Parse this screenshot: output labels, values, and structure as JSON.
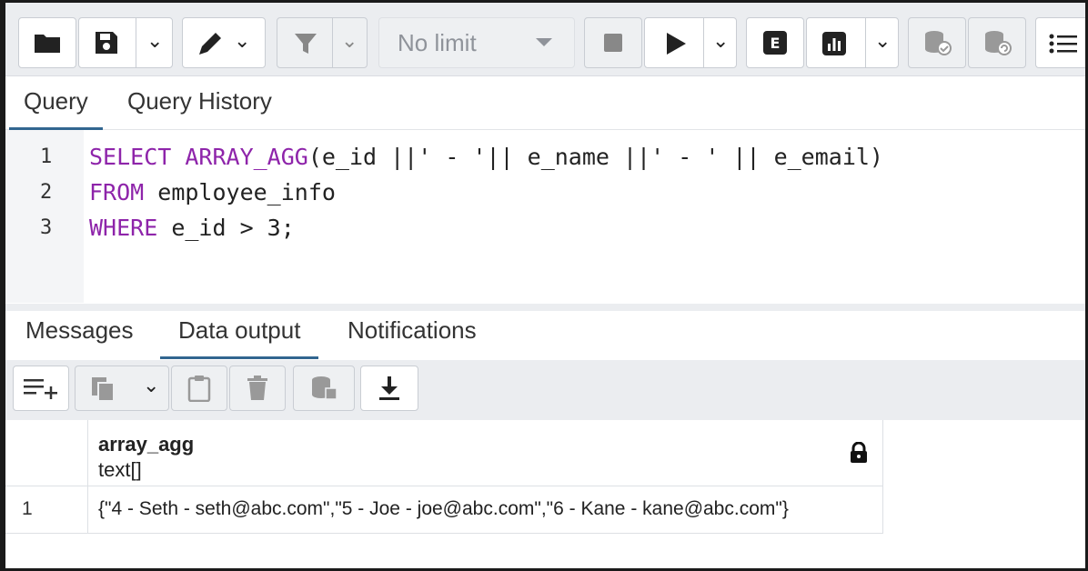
{
  "toolbar": {
    "limit_select": "No limit",
    "icons": [
      "folder-icon",
      "save-icon",
      "chevron-down-icon",
      "pen-icon",
      "filter-icon",
      "stop-icon",
      "play-icon",
      "explain-icon",
      "explain-analyze-icon",
      "commit-icon",
      "rollback-icon",
      "macros-icon"
    ]
  },
  "query_tabs": [
    {
      "label": "Query",
      "active": true
    },
    {
      "label": "Query History",
      "active": false
    }
  ],
  "editor": {
    "lines": [
      {
        "num": "1",
        "kw": "SELECT ARRAY_AGG",
        "rest": "(e_id ||' - '|| e_name ||' - ' || e_email)"
      },
      {
        "num": "2",
        "kw": "FROM",
        "rest": " employee_info"
      },
      {
        "num": "3",
        "kw": "WHERE",
        "rest": " e_id > 3;"
      }
    ]
  },
  "output_tabs": [
    {
      "label": "Messages",
      "active": false
    },
    {
      "label": "Data output",
      "active": true
    },
    {
      "label": "Notifications",
      "active": false
    }
  ],
  "grid": {
    "columns": [
      {
        "name": "array_agg",
        "type": "text[]"
      }
    ],
    "rows": [
      {
        "num": "1",
        "cells": [
          "{\"4 - Seth - seth@abc.com\",\"5 - Joe - joe@abc.com\",\"6 - Kane - kane@abc.com\"}"
        ]
      }
    ]
  },
  "colors": {
    "keyword": "#8e24aa",
    "tab_underline": "#326690",
    "toolbar_bg": "#ebedf0"
  }
}
